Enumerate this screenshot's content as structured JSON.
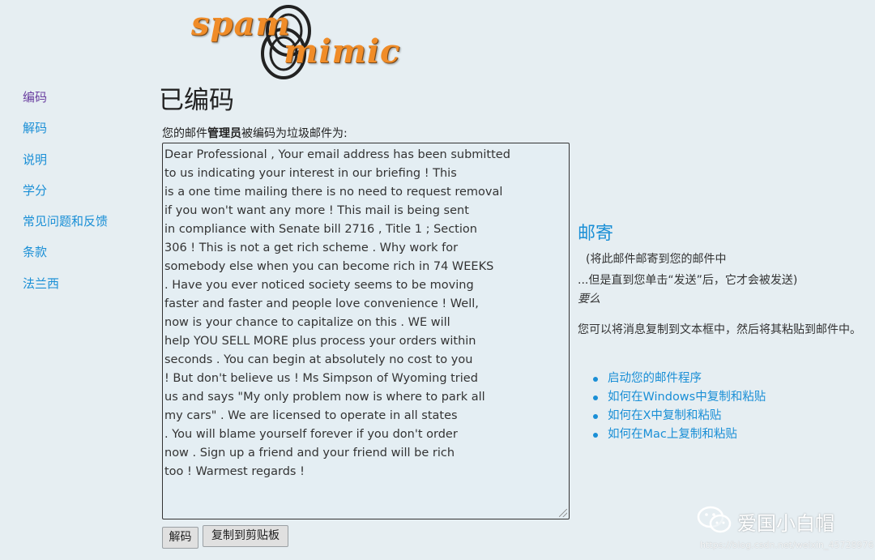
{
  "logo": {
    "word1": "spam",
    "word2": "mimic"
  },
  "sidebar": {
    "items": [
      {
        "label": "编码"
      },
      {
        "label": "解码"
      },
      {
        "label": "说明"
      },
      {
        "label": "学分"
      },
      {
        "label": "常见问题和反馈"
      },
      {
        "label": "条款"
      },
      {
        "label": "法兰西"
      }
    ]
  },
  "main": {
    "title": "已编码",
    "intro_prefix": "您的邮件",
    "intro_bold": "管理员",
    "intro_suffix": "被编码为垃圾邮件为:",
    "encoded_lines": [
      "Dear Professional , Your email address has been submitted",
      "to us indicating your interest in our briefing ! This",
      "is a one time mailing there is no need to request removal",
      "if you won't want any more ! This mail is being sent",
      "in compliance with Senate bill 2716 , Title 1 ; Section",
      "306 ! This is not a get rich scheme . Why work for",
      "somebody else when you can become rich in 74 WEEKS",
      ". Have you ever noticed society seems to be moving",
      "faster and faster and people love convenience ! Well,",
      "now is your chance to capitalize on this . WE will",
      "help YOU SELL MORE plus process your orders within",
      "seconds . You can begin at absolutely no cost to you",
      "! But don't believe us ! Ms Simpson of Wyoming tried",
      "us and says \"My only problem now is where to park all",
      "my cars\" . We are licensed to operate in all states",
      ". You will blame yourself forever if you don't order",
      "now . Sign up a friend and your friend will be rich",
      "too ! Warmest regards !"
    ],
    "decode_button": "解码",
    "copy_button": "复制到剪贴板"
  },
  "mail_panel": {
    "heading": "邮寄",
    "note1": "(将此邮件邮寄到您的邮件中",
    "note2": "...但是直到您单击“发送”后，它才会被发送)",
    "note3": "要么",
    "paragraph": "您可以将消息复制到文本框中，然后将其粘贴到邮件中。",
    "links": [
      {
        "label": "启动您的邮件程序"
      },
      {
        "label": "如何在Windows中复制和粘贴"
      },
      {
        "label": "如何在X中复制和粘贴"
      },
      {
        "label": "如何在Mac上复制和粘贴"
      }
    ]
  },
  "watermark": {
    "text": "爱国小白帽",
    "url": "https://blog.csdn.net/weixin_45728976"
  },
  "colors": {
    "background": "#e6eef2",
    "link": "#1a8fd6",
    "visited_link": "#6a3fa0",
    "logo_orange": "#f08c28"
  }
}
